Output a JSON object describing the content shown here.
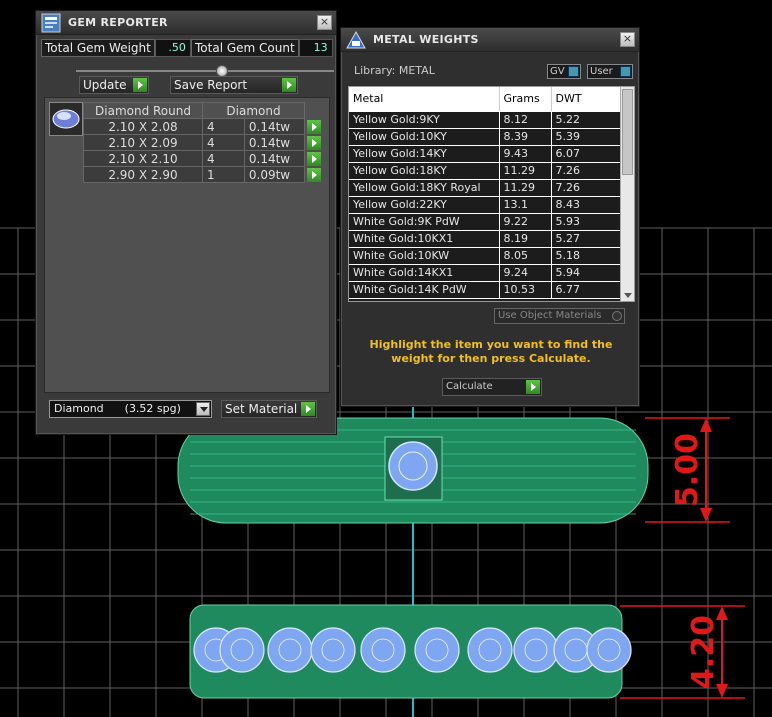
{
  "gem_reporter": {
    "title": "GEM REPORTER",
    "close": "×",
    "total_weight_label": "Total Gem Weight",
    "total_weight_value": ".50",
    "total_count_label": "Total Gem Count",
    "total_count_value": "13",
    "update_label": "Update",
    "save_report_label": "Save Report",
    "table_header_shape": "Diamond Round",
    "table_header_material": "Diamond",
    "rows": [
      {
        "size": "2.10 X 2.08",
        "count": "4",
        "weight": "0.14tw"
      },
      {
        "size": "2.10 X 2.09",
        "count": "4",
        "weight": "0.14tw"
      },
      {
        "size": "2.10 X 2.10",
        "count": "4",
        "weight": "0.14tw"
      },
      {
        "size": "2.90 X 2.90",
        "count": "1",
        "weight": "0.09tw"
      }
    ],
    "material_select": "Diamond      (3.52 spg)",
    "set_material_label": "Set Material"
  },
  "metal_weights": {
    "title": "METAL WEIGHTS",
    "close": "×",
    "library_label": "Library: METAL",
    "gv_label": "GV",
    "user_label": "User",
    "col_metal": "Metal",
    "col_grams": "Grams",
    "col_dwt": "DWT",
    "rows": [
      {
        "metal": "Yellow Gold:9KY",
        "grams": "8.12",
        "dwt": "5.22"
      },
      {
        "metal": "Yellow Gold:10KY",
        "grams": "8.39",
        "dwt": "5.39"
      },
      {
        "metal": "Yellow Gold:14KY",
        "grams": "9.43",
        "dwt": "6.07"
      },
      {
        "metal": "Yellow Gold:18KY",
        "grams": "11.29",
        "dwt": "7.26"
      },
      {
        "metal": "Yellow Gold:18KY Royal",
        "grams": "11.29",
        "dwt": "7.26"
      },
      {
        "metal": "Yellow Gold:22KY",
        "grams": "13.1",
        "dwt": "8.43"
      },
      {
        "metal": "White Gold:9K PdW",
        "grams": "9.22",
        "dwt": "5.93"
      },
      {
        "metal": "White Gold:10KX1",
        "grams": "8.19",
        "dwt": "5.27"
      },
      {
        "metal": "White Gold:10KW",
        "grams": "8.05",
        "dwt": "5.18"
      },
      {
        "metal": "White Gold:14KX1",
        "grams": "9.24",
        "dwt": "5.94"
      },
      {
        "metal": "White Gold:14K PdW",
        "grams": "10.53",
        "dwt": "6.77"
      }
    ],
    "use_object_materials": "Use Object Materials",
    "hint": "Highlight the item you want to find the weight for then press Calculate.",
    "calculate_label": "Calculate"
  },
  "viewport": {
    "dim_top": "5.00",
    "dim_bottom": "4.20",
    "colors": {
      "band": "#1f8a5e",
      "gem": "#7fa6f0",
      "dimension": "#e01818",
      "grid": "#8a8a8a"
    }
  }
}
